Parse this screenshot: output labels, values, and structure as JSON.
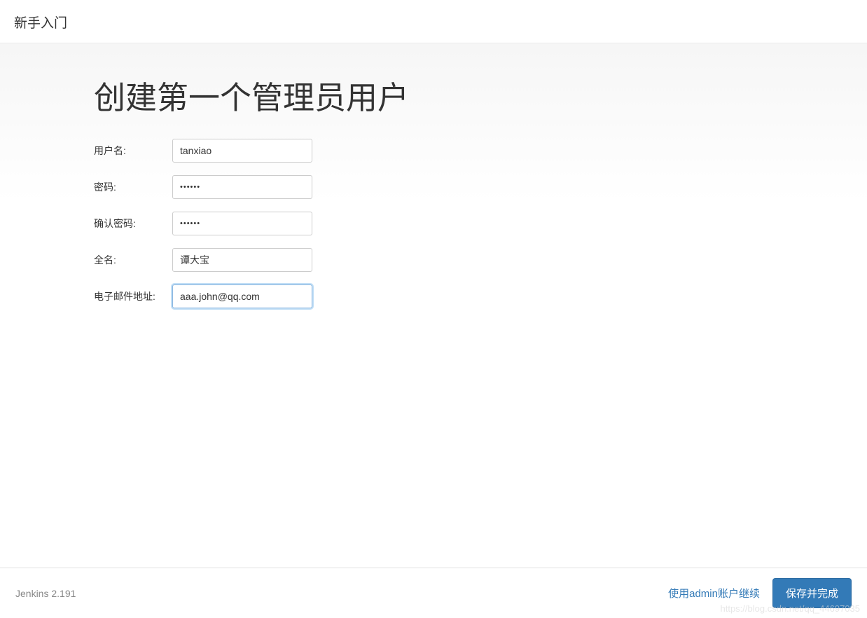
{
  "header": {
    "title": "新手入门"
  },
  "main": {
    "heading": "创建第一个管理员用户",
    "form": {
      "username": {
        "label": "用户名:",
        "value": "tanxiao"
      },
      "password": {
        "label": "密码:",
        "value": "••••••"
      },
      "confirm_password": {
        "label": "确认密码:",
        "value": "••••••"
      },
      "fullname": {
        "label": "全名:",
        "value": "谭大宝"
      },
      "email": {
        "label": "电子邮件地址:",
        "value": "aaa.john@qq.com"
      }
    }
  },
  "footer": {
    "version": "Jenkins 2.191",
    "continue_as_admin": "使用admin账户继续",
    "save_and_finish": "保存并完成"
  },
  "watermark": "https://blog.csdn.net/qq_44697035"
}
